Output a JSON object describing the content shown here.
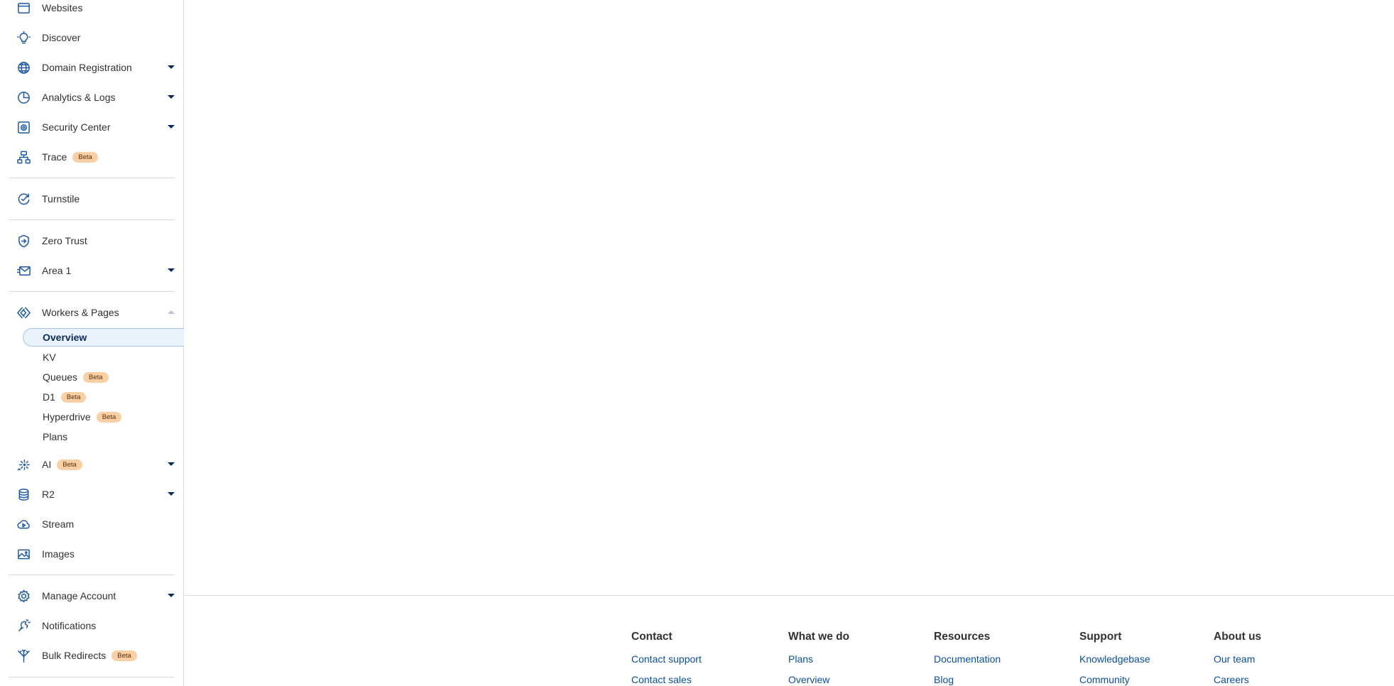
{
  "sidebar": {
    "items": [
      {
        "label": "Websites",
        "icon": "window-icon"
      },
      {
        "label": "Discover",
        "icon": "lightbulb-icon"
      },
      {
        "label": "Domain Registration",
        "icon": "globe-icon"
      },
      {
        "label": "Analytics & Logs",
        "icon": "pie-chart-icon"
      },
      {
        "label": "Security Center",
        "icon": "security-center-icon"
      },
      {
        "label": "Trace",
        "icon": "trace-icon",
        "badge": "Beta"
      },
      {
        "label": "Turnstile",
        "icon": "turnstile-icon"
      },
      {
        "label": "Zero Trust",
        "icon": "zero-trust-icon"
      },
      {
        "label": "Area 1",
        "icon": "email-icon"
      },
      {
        "label": "Workers & Pages",
        "icon": "workers-icon"
      },
      {
        "label": "AI",
        "icon": "ai-sparkle-icon",
        "badge": "Beta"
      },
      {
        "label": "R2",
        "icon": "database-icon"
      },
      {
        "label": "Stream",
        "icon": "cloud-play-icon"
      },
      {
        "label": "Images",
        "icon": "image-icon"
      },
      {
        "label": "Manage Account",
        "icon": "gear-icon"
      },
      {
        "label": "Notifications",
        "icon": "notification-icon"
      },
      {
        "label": "Bulk Redirects",
        "icon": "redirect-icon",
        "badge": "Beta"
      }
    ],
    "workers_sub": [
      {
        "label": "Overview",
        "active": true
      },
      {
        "label": "KV"
      },
      {
        "label": "Queues",
        "badge": "Beta"
      },
      {
        "label": "D1",
        "badge": "Beta"
      },
      {
        "label": "Hyperdrive",
        "badge": "Beta"
      },
      {
        "label": "Plans"
      }
    ]
  },
  "footer": {
    "columns": [
      {
        "heading": "Contact",
        "links": [
          "Contact support",
          "Contact sales"
        ]
      },
      {
        "heading": "What we do",
        "links": [
          "Plans",
          "Overview"
        ]
      },
      {
        "heading": "Resources",
        "links": [
          "Documentation",
          "Blog"
        ]
      },
      {
        "heading": "Support",
        "links": [
          "Knowledgebase",
          "Community"
        ]
      },
      {
        "heading": "About us",
        "links": [
          "Our team",
          "Careers"
        ]
      }
    ]
  },
  "colors": {
    "accent": "#1f5aa6",
    "link": "#0b4fa3",
    "badge_bg": "#fbcfa4",
    "active_bg": "#eaf2fc"
  }
}
